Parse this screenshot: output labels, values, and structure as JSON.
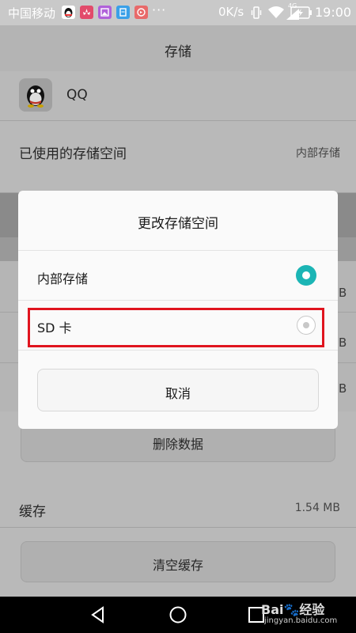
{
  "status_bar": {
    "carrier": "中国移动",
    "more": "···",
    "net_speed": "0K/s",
    "signal_type": "4G",
    "time": "19:00",
    "notification_icons": [
      {
        "icon": "qq-icon",
        "color": "#ffffff"
      },
      {
        "icon": "huawei-icon",
        "color": "#e24b6b"
      },
      {
        "icon": "gallery-icon",
        "color": "#b061d9"
      },
      {
        "icon": "file-icon",
        "color": "#3aa0e8"
      },
      {
        "icon": "phone-manager-icon",
        "color": "#e86a6a"
      }
    ]
  },
  "header": {
    "title": "存储"
  },
  "app": {
    "name": "QQ"
  },
  "storage_used": {
    "label": "已使用的存储空间",
    "value": "内部存储"
  },
  "background_buttons": {
    "delete_data": "删除数据",
    "clear_cache": "清空缓存"
  },
  "cache": {
    "label": "缓存",
    "value": "1.54 MB"
  },
  "dialog": {
    "title": "更改存储空间",
    "options": [
      {
        "label": "内部存储",
        "selected": true
      },
      {
        "label": "SD 卡",
        "selected": false
      }
    ],
    "cancel_label": "取消",
    "accent_color": "#1bb5b5",
    "highlight_color": "#e0141e"
  },
  "watermark": {
    "brand": "Bai🐾经验",
    "url": "jingyan.baidu.com"
  }
}
